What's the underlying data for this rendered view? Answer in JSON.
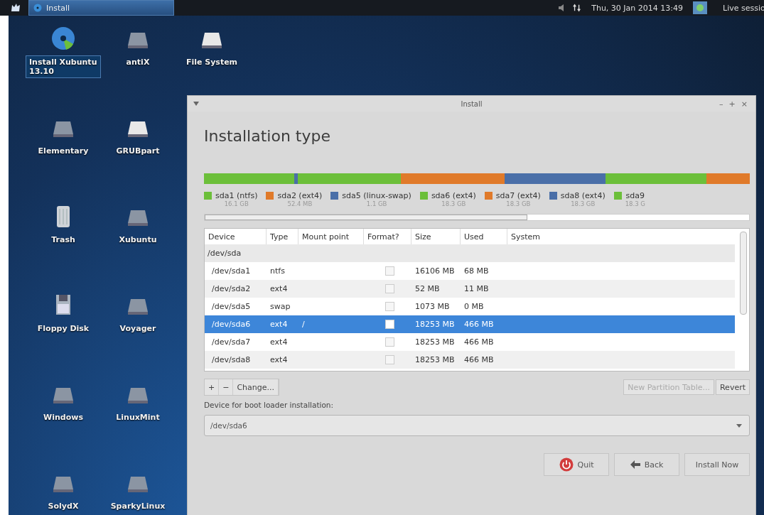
{
  "panel": {
    "task": "Install",
    "clock": "Thu, 30 Jan 2014 13:49",
    "session": "Live sessio"
  },
  "desktop_icons": [
    {
      "label": "Install Xubuntu 13.10",
      "kind": "disc",
      "selected": true
    },
    {
      "label": "antiX",
      "kind": "drive",
      "selected": false
    },
    {
      "label": "File System",
      "kind": "drive-light",
      "selected": false
    },
    {
      "label": "Elementary",
      "kind": "drive",
      "selected": false
    },
    {
      "label": "GRUBpart",
      "kind": "drive-light",
      "selected": false
    },
    {
      "label": "Trash",
      "kind": "trash",
      "selected": false
    },
    {
      "label": "Xubuntu",
      "kind": "drive",
      "selected": false
    },
    {
      "label": "Floppy Disk",
      "kind": "floppy",
      "selected": false
    },
    {
      "label": "Voyager",
      "kind": "drive",
      "selected": false
    },
    {
      "label": "Windows",
      "kind": "drive",
      "selected": false
    },
    {
      "label": "LinuxMint",
      "kind": "drive",
      "selected": false
    },
    {
      "label": "SolydX",
      "kind": "drive",
      "selected": false
    },
    {
      "label": "SparkyLinux",
      "kind": "drive",
      "selected": false
    }
  ],
  "window": {
    "title": "Install",
    "controls": [
      "–",
      "+",
      "×"
    ],
    "heading": "Installation type"
  },
  "partitions": [
    {
      "label": "sda1 (ntfs)",
      "size": "16.1 GB",
      "color": "#6cbf3a"
    },
    {
      "label": "sda2 (ext4)",
      "size": "52.4 MB",
      "color": "#e07a2a"
    },
    {
      "label": "sda5 (linux-swap)",
      "size": "1.1 GB",
      "color": "#4a6fa8"
    },
    {
      "label": "sda6 (ext4)",
      "size": "18.3 GB",
      "color": "#6cbf3a"
    },
    {
      "label": "sda7 (ext4)",
      "size": "18.3 GB",
      "color": "#e07a2a"
    },
    {
      "label": "sda8 (ext4)",
      "size": "18.3 GB",
      "color": "#4a6fa8"
    },
    {
      "label": "sda9",
      "size": "18.3 G",
      "color": "#6cbf3a"
    }
  ],
  "table": {
    "columns": [
      "Device",
      "Type",
      "Mount point",
      "Format?",
      "Size",
      "Used",
      "System"
    ],
    "group": "/dev/sda",
    "rows": [
      {
        "device": "/dev/sda1",
        "type": "ntfs",
        "mount": "",
        "format": false,
        "size": "16106 MB",
        "used": "68 MB",
        "selected": false
      },
      {
        "device": "/dev/sda2",
        "type": "ext4",
        "mount": "",
        "format": false,
        "size": "52 MB",
        "used": "11 MB",
        "selected": false
      },
      {
        "device": "/dev/sda5",
        "type": "swap",
        "mount": "",
        "format": false,
        "size": "1073 MB",
        "used": "0 MB",
        "selected": false
      },
      {
        "device": "/dev/sda6",
        "type": "ext4",
        "mount": "/",
        "format": false,
        "size": "18253 MB",
        "used": "466 MB",
        "selected": true
      },
      {
        "device": "/dev/sda7",
        "type": "ext4",
        "mount": "",
        "format": false,
        "size": "18253 MB",
        "used": "466 MB",
        "selected": false
      },
      {
        "device": "/dev/sda8",
        "type": "ext4",
        "mount": "",
        "format": false,
        "size": "18253 MB",
        "used": "466 MB",
        "selected": false
      }
    ]
  },
  "partition_buttons": {
    "add": "+",
    "remove": "−",
    "change": "Change...",
    "new_table": "New Partition Table...",
    "revert": "Revert"
  },
  "bootloader": {
    "label": "Device for boot loader installation:",
    "value": "/dev/sda6"
  },
  "buttons": {
    "quit": "Quit",
    "back": "Back",
    "install": "Install Now"
  }
}
